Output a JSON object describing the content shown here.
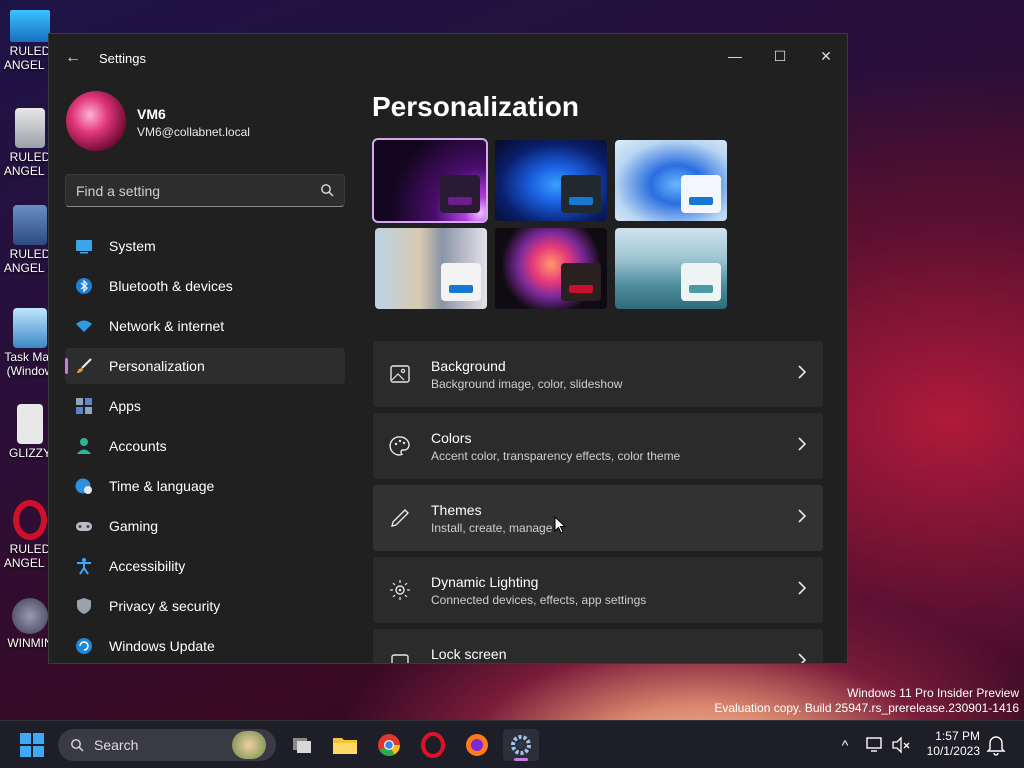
{
  "desktop": {
    "icons": [
      {
        "label": "RULED ANGEL D",
        "icon": "monitor-icon"
      },
      {
        "label": "RULED ANGEL D",
        "icon": "recycle-bin-icon"
      },
      {
        "label": "RULED ANGEL D",
        "icon": "virtualbox-icon"
      },
      {
        "label": "Task Man (Window",
        "icon": "task-manager-icon"
      },
      {
        "label": "GLIZZY",
        "icon": "document-icon"
      },
      {
        "label": "RULED ANGEL D",
        "icon": "opera-icon"
      },
      {
        "label": "WINMIN",
        "icon": "mine-icon"
      }
    ]
  },
  "window": {
    "title": "Settings",
    "back_glyph": "←",
    "minimize_glyph": "—",
    "maximize_glyph": "☐",
    "close_glyph": "✕"
  },
  "sidebar": {
    "profile": {
      "name": "VM6",
      "email": "VM6@collabnet.local"
    },
    "search_placeholder": "Find a setting",
    "items": [
      {
        "label": "System",
        "icon": "system-icon"
      },
      {
        "label": "Bluetooth & devices",
        "icon": "bluetooth-icon"
      },
      {
        "label": "Network & internet",
        "icon": "wifi-icon"
      },
      {
        "label": "Personalization",
        "icon": "brush-icon",
        "active": true
      },
      {
        "label": "Apps",
        "icon": "apps-icon"
      },
      {
        "label": "Accounts",
        "icon": "accounts-icon"
      },
      {
        "label": "Time & language",
        "icon": "globe-clock-icon"
      },
      {
        "label": "Gaming",
        "icon": "gamepad-icon"
      },
      {
        "label": "Accessibility",
        "icon": "accessibility-icon"
      },
      {
        "label": "Privacy & security",
        "icon": "shield-icon"
      },
      {
        "label": "Windows Update",
        "icon": "update-icon"
      }
    ]
  },
  "main": {
    "title": "Personalization",
    "themes": [
      {
        "name": "glow-purple",
        "accent": "#6b1e8c",
        "selected": true
      },
      {
        "name": "bloom-dark",
        "accent": "#1678d0"
      },
      {
        "name": "bloom-light",
        "accent": "#1678d0"
      },
      {
        "name": "captured-motion",
        "accent": "#1678d0"
      },
      {
        "name": "flow",
        "accent": "#c8102e"
      },
      {
        "name": "sunrise-lake",
        "accent": "#4a9aa5"
      }
    ],
    "cards": [
      {
        "title": "Background",
        "subtitle": "Background image, color, slideshow",
        "icon": "image-icon"
      },
      {
        "title": "Colors",
        "subtitle": "Accent color, transparency effects, color theme",
        "icon": "palette-icon"
      },
      {
        "title": "Themes",
        "subtitle": "Install, create, manage",
        "icon": "pen-icon"
      },
      {
        "title": "Dynamic Lighting",
        "subtitle": "Connected devices, effects, app settings",
        "icon": "lighting-icon"
      },
      {
        "title": "Lock screen",
        "subtitle": "",
        "icon": "lock-screen-icon"
      }
    ]
  },
  "watermark": {
    "line1": "Windows 11 Pro Insider Preview",
    "line2": "Evaluation copy. Build 25947.rs_prerelease.230901-1416"
  },
  "taskbar": {
    "search_label": "Search",
    "apps": [
      "task-view-icon",
      "file-explorer-icon",
      "chrome-icon",
      "opera-icon",
      "firefox-icon",
      "settings-icon"
    ],
    "tray_chevron": "^",
    "time": "1:57 PM",
    "date": "10/1/2023"
  },
  "colors": {
    "accent": "#c879e6",
    "window_bg": "#202020",
    "card_bg": "#2b2b2b"
  }
}
